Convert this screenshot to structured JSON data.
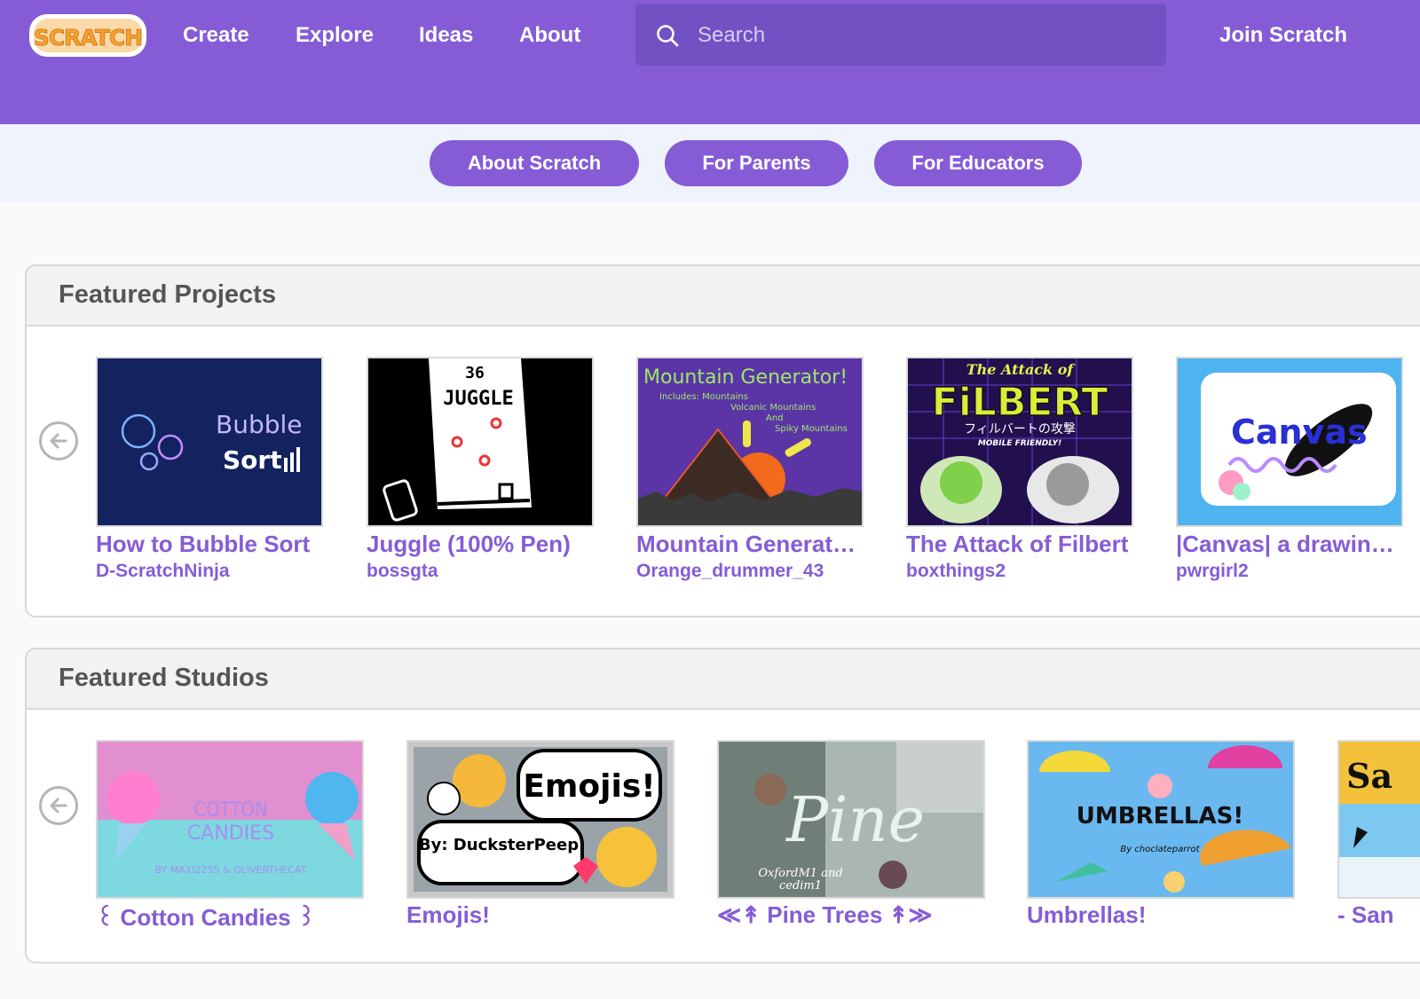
{
  "colors": {
    "brand_purple": "#855cd6",
    "search_bg": "#7251c3",
    "subnav_bg": "#eef3fc",
    "text_gray": "#555555",
    "logo_orange": "#f7a02f"
  },
  "header": {
    "logo_text": "SCRATCH",
    "nav": [
      "Create",
      "Explore",
      "Ideas",
      "About"
    ],
    "search_placeholder": "Search",
    "join_label": "Join Scratch"
  },
  "subnav": {
    "buttons": [
      "About Scratch",
      "For Parents",
      "For Educators"
    ]
  },
  "featured_projects": {
    "title": "Featured Projects",
    "items": [
      {
        "title": "How to Bubble Sort",
        "author": "D-ScratchNinja",
        "thumb_text": [
          "Bubble",
          "Sort"
        ]
      },
      {
        "title": "Juggle (100% Pen)",
        "author": "bossgta",
        "thumb_text": [
          "36",
          "JUGGLE"
        ]
      },
      {
        "title": "Mountain Generat…",
        "author": "Orange_drummer_43",
        "thumb_text": [
          "Mountain Generator!",
          "Includes: Mountains",
          "Volcanic Mountains",
          "And",
          "Spiky Mountains"
        ]
      },
      {
        "title": "The Attack of Filbert",
        "author": "boxthings2",
        "thumb_text": [
          "The Attack of",
          "FiLBERT",
          "フィルバートの攻撃",
          "MOBILE FRIENDLY!"
        ]
      },
      {
        "title": "|Canvas| a drawin…",
        "author": "pwrgirl2",
        "thumb_text": [
          "Canvas"
        ]
      }
    ]
  },
  "featured_studios": {
    "title": "Featured Studios",
    "items": [
      {
        "title": "꒰ Cotton Candies ꒱",
        "thumb_text": [
          "COTTON",
          "CANDIES",
          "BY MAXI2255 & OLIVERTHECAT"
        ]
      },
      {
        "title": "Emojis!",
        "thumb_text": [
          "Emojis!",
          "By: DucksterPeep"
        ]
      },
      {
        "title": "≪↟ Pine Trees ↟≫",
        "thumb_text": [
          "Pine",
          "OxfordM1 and",
          "cedim1"
        ]
      },
      {
        "title": "Umbrellas!",
        "thumb_text": [
          "UMBRELLAS!",
          "By choclateparrot"
        ]
      },
      {
        "title": "- San",
        "thumb_text": [
          "Sa"
        ]
      }
    ]
  }
}
